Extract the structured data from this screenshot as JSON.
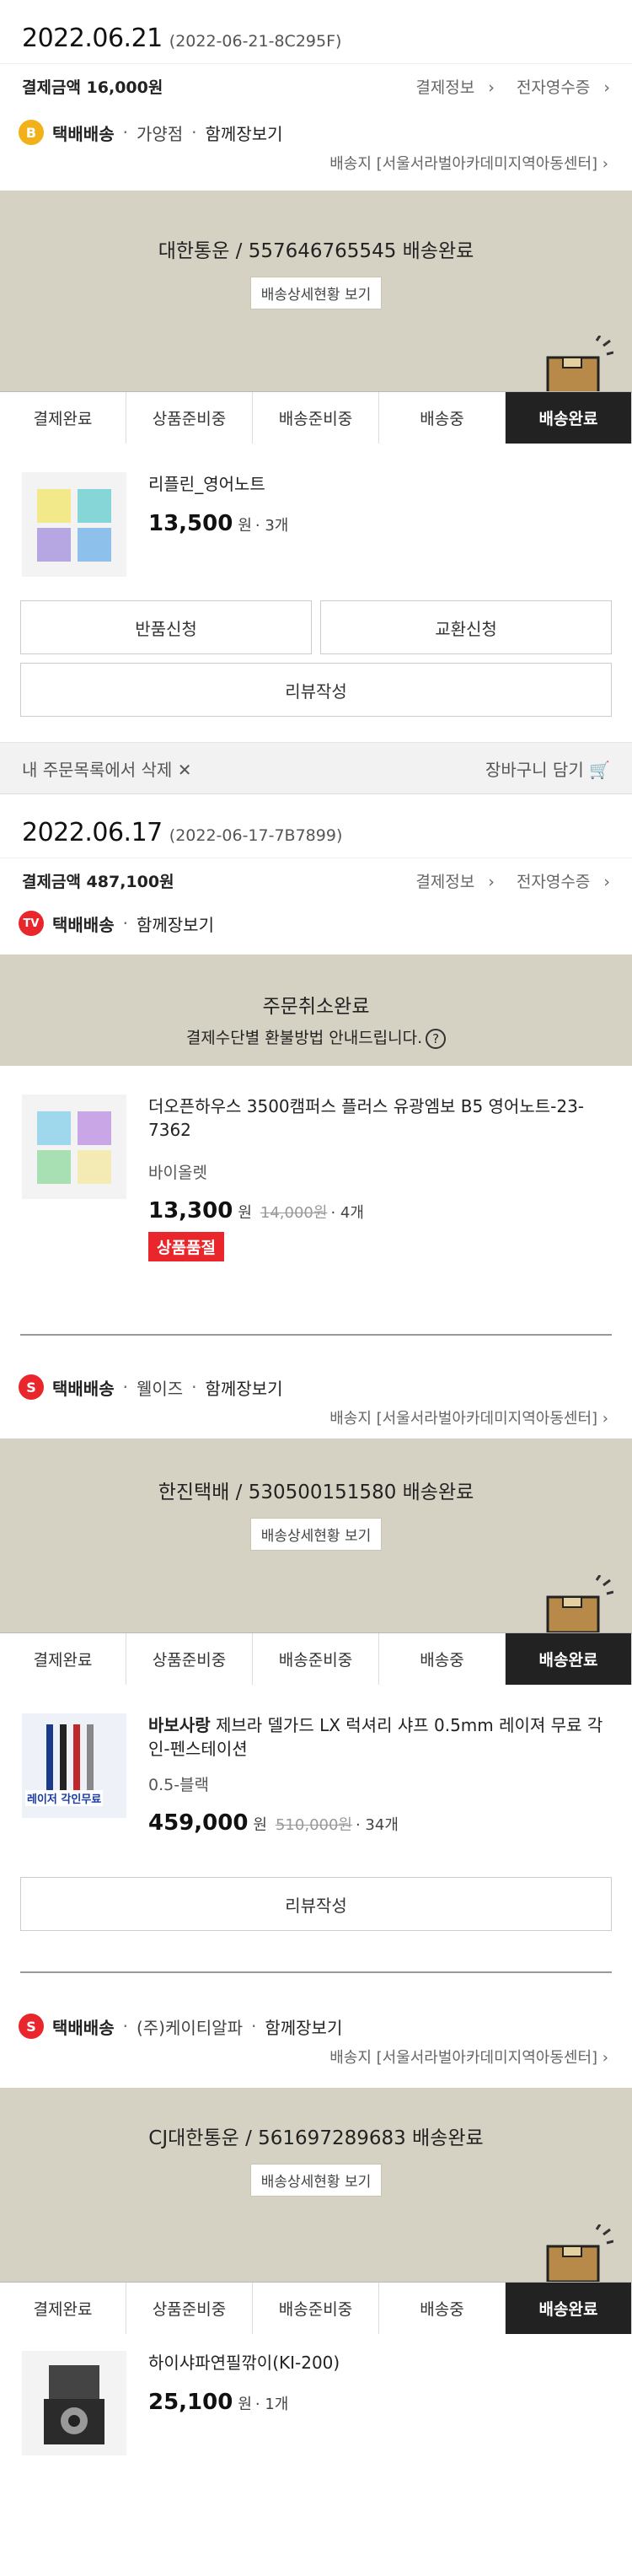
{
  "common": {
    "pay_info": "결제정보",
    "receipt": "전자영수증",
    "ship_type": "택배배송",
    "together": "함께장보기",
    "track_detail": "배송상세현황 보기",
    "steps": [
      "결제완료",
      "상품준비중",
      "배송준비중",
      "배송중",
      "배송완료"
    ],
    "won": "원",
    "review": "리뷰작성",
    "chevron": "›"
  },
  "order1": {
    "date": "2022.06.21",
    "order_no": "(2022-06-21-8C295F)",
    "amount": "결제금액 16,000원",
    "seller_badge": "B",
    "seller": "가양점",
    "address": "배송지 [서울서라벌아카데미지역아동센터]",
    "tracking": "대한통운 / 557646765545 배송완료",
    "product": {
      "name": "리플린_영어노트",
      "price": "13,500",
      "qty": "· 3개"
    },
    "return_btn": "반품신청",
    "exchange_btn": "교환신청",
    "delete": "내 주문목록에서 삭제",
    "cart": "장바구니 담기"
  },
  "order2": {
    "date": "2022.06.17",
    "order_no": "(2022-06-17-7B7899)",
    "amount": "결제금액 487,100원",
    "badge": "TV",
    "cancel_title": "주문취소완료",
    "cancel_sub": "결제수단별 환불방법 안내드립니다.",
    "product": {
      "name": "더오픈하우스 3500캠퍼스 플러스 유광엠보 B5 영어노트-23-7362",
      "option": "바이올렛",
      "price": "13,300",
      "orig": "14,000원",
      "qty": "· 4개",
      "soldout": "상품품절"
    },
    "group2": {
      "badge": "S",
      "seller": "웰이즈",
      "address": "배송지 [서울서라벌아카데미지역아동센터]",
      "tracking": "한진택배 / 530500151580 배송완료",
      "product": {
        "brand": "바보사랑",
        "name": " 제브라 델가드 LX 럭셔리 샤프 0.5mm 레이져 무료 각인-펜스테이션",
        "option": "0.5-블랙",
        "price": "459,000",
        "orig": "510,000원",
        "qty": "· 34개",
        "thumb_text": "레이저 각인무료"
      }
    },
    "group3": {
      "badge": "S",
      "seller": "(주)케이티알파",
      "address": "배송지 [서울서라벌아카데미지역아동센터]",
      "tracking": "CJ대한통운 / 561697289683 배송완료",
      "product": {
        "name": "하이샤파연필깎이(KI-200)",
        "price": "25,100",
        "qty": "· 1개"
      }
    }
  }
}
